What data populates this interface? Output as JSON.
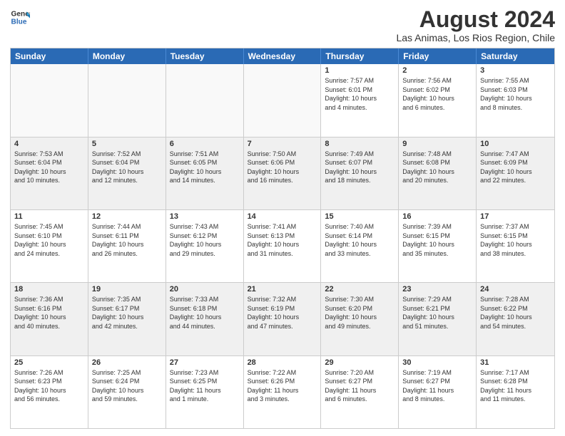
{
  "header": {
    "logo_line1": "General",
    "logo_line2": "Blue",
    "main_title": "August 2024",
    "subtitle": "Las Animas, Los Rios Region, Chile"
  },
  "calendar": {
    "days_of_week": [
      "Sunday",
      "Monday",
      "Tuesday",
      "Wednesday",
      "Thursday",
      "Friday",
      "Saturday"
    ],
    "weeks": [
      [
        {
          "day": "",
          "info": "",
          "empty": true
        },
        {
          "day": "",
          "info": "",
          "empty": true
        },
        {
          "day": "",
          "info": "",
          "empty": true
        },
        {
          "day": "",
          "info": "",
          "empty": true
        },
        {
          "day": "1",
          "info": "Sunrise: 7:57 AM\nSunset: 6:01 PM\nDaylight: 10 hours\nand 4 minutes."
        },
        {
          "day": "2",
          "info": "Sunrise: 7:56 AM\nSunset: 6:02 PM\nDaylight: 10 hours\nand 6 minutes."
        },
        {
          "day": "3",
          "info": "Sunrise: 7:55 AM\nSunset: 6:03 PM\nDaylight: 10 hours\nand 8 minutes."
        }
      ],
      [
        {
          "day": "4",
          "info": "Sunrise: 7:53 AM\nSunset: 6:04 PM\nDaylight: 10 hours\nand 10 minutes."
        },
        {
          "day": "5",
          "info": "Sunrise: 7:52 AM\nSunset: 6:04 PM\nDaylight: 10 hours\nand 12 minutes."
        },
        {
          "day": "6",
          "info": "Sunrise: 7:51 AM\nSunset: 6:05 PM\nDaylight: 10 hours\nand 14 minutes."
        },
        {
          "day": "7",
          "info": "Sunrise: 7:50 AM\nSunset: 6:06 PM\nDaylight: 10 hours\nand 16 minutes."
        },
        {
          "day": "8",
          "info": "Sunrise: 7:49 AM\nSunset: 6:07 PM\nDaylight: 10 hours\nand 18 minutes."
        },
        {
          "day": "9",
          "info": "Sunrise: 7:48 AM\nSunset: 6:08 PM\nDaylight: 10 hours\nand 20 minutes."
        },
        {
          "day": "10",
          "info": "Sunrise: 7:47 AM\nSunset: 6:09 PM\nDaylight: 10 hours\nand 22 minutes."
        }
      ],
      [
        {
          "day": "11",
          "info": "Sunrise: 7:45 AM\nSunset: 6:10 PM\nDaylight: 10 hours\nand 24 minutes."
        },
        {
          "day": "12",
          "info": "Sunrise: 7:44 AM\nSunset: 6:11 PM\nDaylight: 10 hours\nand 26 minutes."
        },
        {
          "day": "13",
          "info": "Sunrise: 7:43 AM\nSunset: 6:12 PM\nDaylight: 10 hours\nand 29 minutes."
        },
        {
          "day": "14",
          "info": "Sunrise: 7:41 AM\nSunset: 6:13 PM\nDaylight: 10 hours\nand 31 minutes."
        },
        {
          "day": "15",
          "info": "Sunrise: 7:40 AM\nSunset: 6:14 PM\nDaylight: 10 hours\nand 33 minutes."
        },
        {
          "day": "16",
          "info": "Sunrise: 7:39 AM\nSunset: 6:15 PM\nDaylight: 10 hours\nand 35 minutes."
        },
        {
          "day": "17",
          "info": "Sunrise: 7:37 AM\nSunset: 6:15 PM\nDaylight: 10 hours\nand 38 minutes."
        }
      ],
      [
        {
          "day": "18",
          "info": "Sunrise: 7:36 AM\nSunset: 6:16 PM\nDaylight: 10 hours\nand 40 minutes."
        },
        {
          "day": "19",
          "info": "Sunrise: 7:35 AM\nSunset: 6:17 PM\nDaylight: 10 hours\nand 42 minutes."
        },
        {
          "day": "20",
          "info": "Sunrise: 7:33 AM\nSunset: 6:18 PM\nDaylight: 10 hours\nand 44 minutes."
        },
        {
          "day": "21",
          "info": "Sunrise: 7:32 AM\nSunset: 6:19 PM\nDaylight: 10 hours\nand 47 minutes."
        },
        {
          "day": "22",
          "info": "Sunrise: 7:30 AM\nSunset: 6:20 PM\nDaylight: 10 hours\nand 49 minutes."
        },
        {
          "day": "23",
          "info": "Sunrise: 7:29 AM\nSunset: 6:21 PM\nDaylight: 10 hours\nand 51 minutes."
        },
        {
          "day": "24",
          "info": "Sunrise: 7:28 AM\nSunset: 6:22 PM\nDaylight: 10 hours\nand 54 minutes."
        }
      ],
      [
        {
          "day": "25",
          "info": "Sunrise: 7:26 AM\nSunset: 6:23 PM\nDaylight: 10 hours\nand 56 minutes."
        },
        {
          "day": "26",
          "info": "Sunrise: 7:25 AM\nSunset: 6:24 PM\nDaylight: 10 hours\nand 59 minutes."
        },
        {
          "day": "27",
          "info": "Sunrise: 7:23 AM\nSunset: 6:25 PM\nDaylight: 11 hours\nand 1 minute."
        },
        {
          "day": "28",
          "info": "Sunrise: 7:22 AM\nSunset: 6:26 PM\nDaylight: 11 hours\nand 3 minutes."
        },
        {
          "day": "29",
          "info": "Sunrise: 7:20 AM\nSunset: 6:27 PM\nDaylight: 11 hours\nand 6 minutes."
        },
        {
          "day": "30",
          "info": "Sunrise: 7:19 AM\nSunset: 6:27 PM\nDaylight: 11 hours\nand 8 minutes."
        },
        {
          "day": "31",
          "info": "Sunrise: 7:17 AM\nSunset: 6:28 PM\nDaylight: 11 hours\nand 11 minutes."
        }
      ]
    ]
  }
}
